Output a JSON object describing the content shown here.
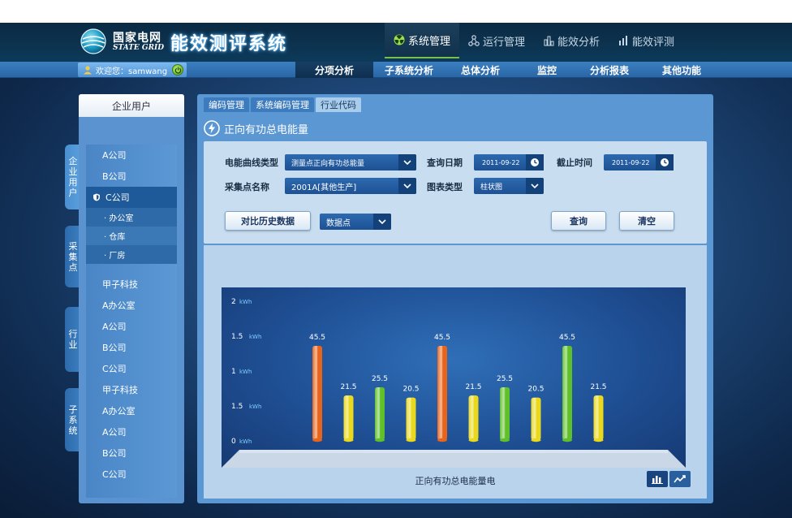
{
  "header": {
    "brand_cn": "国家电网",
    "brand_en": "STATE GRID",
    "app_title": "能效测评系统",
    "nav": [
      {
        "label": "系统管理",
        "icon": "radiation-icon",
        "active": true
      },
      {
        "label": "运行管理",
        "icon": "nodes-icon",
        "active": false
      },
      {
        "label": "能效分析",
        "icon": "building-chart-icon",
        "active": false
      },
      {
        "label": "能效评测",
        "icon": "bars-icon",
        "active": false
      }
    ]
  },
  "subbar": {
    "user_text": "欢迎您：samwang",
    "nav": [
      {
        "label": "分项分析",
        "active": true
      },
      {
        "label": "子系统分析",
        "active": false
      },
      {
        "label": "总体分析",
        "active": false
      },
      {
        "label": "监控",
        "active": false
      },
      {
        "label": "分析报表",
        "active": false
      },
      {
        "label": "其他功能",
        "active": false
      }
    ]
  },
  "side_tabs": [
    {
      "label": "企业用户",
      "active": true
    },
    {
      "label": "采集点",
      "active": false
    },
    {
      "label": "行业",
      "active": false
    },
    {
      "label": "子系统",
      "active": false
    }
  ],
  "sidebar": {
    "title": "企业用户",
    "items_top": [
      {
        "label": "A公司"
      },
      {
        "label": "B公司"
      }
    ],
    "active_item": "C公司",
    "sub_items": [
      "· 办公室",
      "· 仓库",
      "· 厂房"
    ],
    "items_bottom": [
      {
        "label": "甲子科技"
      },
      {
        "label": "A办公室"
      },
      {
        "label": "A公司"
      },
      {
        "label": "B公司"
      },
      {
        "label": "C公司"
      },
      {
        "label": "甲子科技"
      },
      {
        "label": "A办公室"
      },
      {
        "label": "A公司"
      },
      {
        "label": "B公司"
      },
      {
        "label": "C公司"
      }
    ]
  },
  "main": {
    "tabs": [
      {
        "label": "编码管理",
        "active": false
      },
      {
        "label": "系统编码管理",
        "active": false
      },
      {
        "label": "行业代码",
        "active": true
      }
    ],
    "panel_title": "正向有功总电能量",
    "form": {
      "curve_type_label": "电能曲线类型",
      "curve_type_value": "测量点正向有功总能量",
      "query_date_label": "查询日期",
      "query_date_value": "2011-09-22",
      "end_time_label": "截止时间",
      "end_time_value": "2011-09-22",
      "point_name_label": "采集点名称",
      "point_name_value": "2001A[其他生产]",
      "chart_type_label": "图表类型",
      "chart_type_value": "柱状图",
      "compare_button": "对比历史数据",
      "datapoint_select": "数据点",
      "query_button": "查询",
      "clear_button": "清空"
    },
    "chart_caption": "正向有功总电能量电"
  },
  "chart_data": {
    "type": "bar",
    "ytick_labels": [
      "0",
      "1.5",
      "1",
      "1.5",
      "2"
    ],
    "yunit": "kWh",
    "ylim": [
      0,
      2
    ],
    "values": [
      45.5,
      21.5,
      25.5,
      20.5,
      45.5,
      21.5,
      25.5,
      20.5,
      45.5,
      21.5
    ],
    "bar_colors": [
      "#e8641a",
      "#e9d81c",
      "#5fc02a",
      "#e9d81c",
      "#e8641a",
      "#e9d81c",
      "#5fc02a",
      "#e9d81c",
      "#5fc02a",
      "#e9d81c"
    ],
    "xlabel": "正向有功总电能量电"
  },
  "colors": {
    "accent_green": "#77c04a",
    "panel_blue": "#5b97d3",
    "header_dark": "#0c3350"
  }
}
